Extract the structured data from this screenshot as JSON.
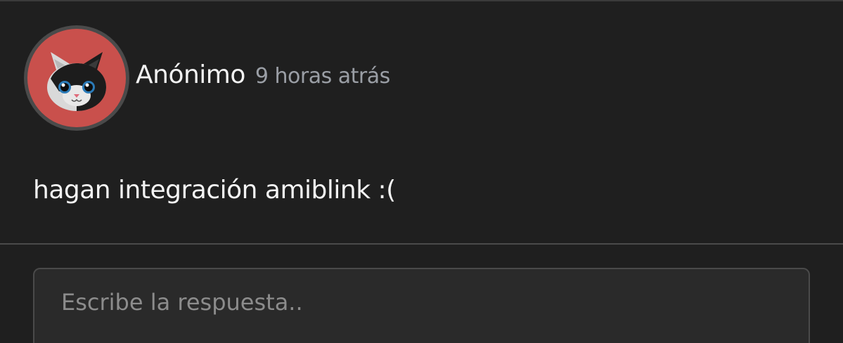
{
  "comment": {
    "author": "Anónimo",
    "time_ago": "9 horas atrás",
    "text": "hagan integración amiblink :(",
    "avatar_icon": "cat-avatar-icon",
    "avatar_bg_color": "#c9504c"
  },
  "reply": {
    "placeholder": "Escribe la respuesta.."
  }
}
